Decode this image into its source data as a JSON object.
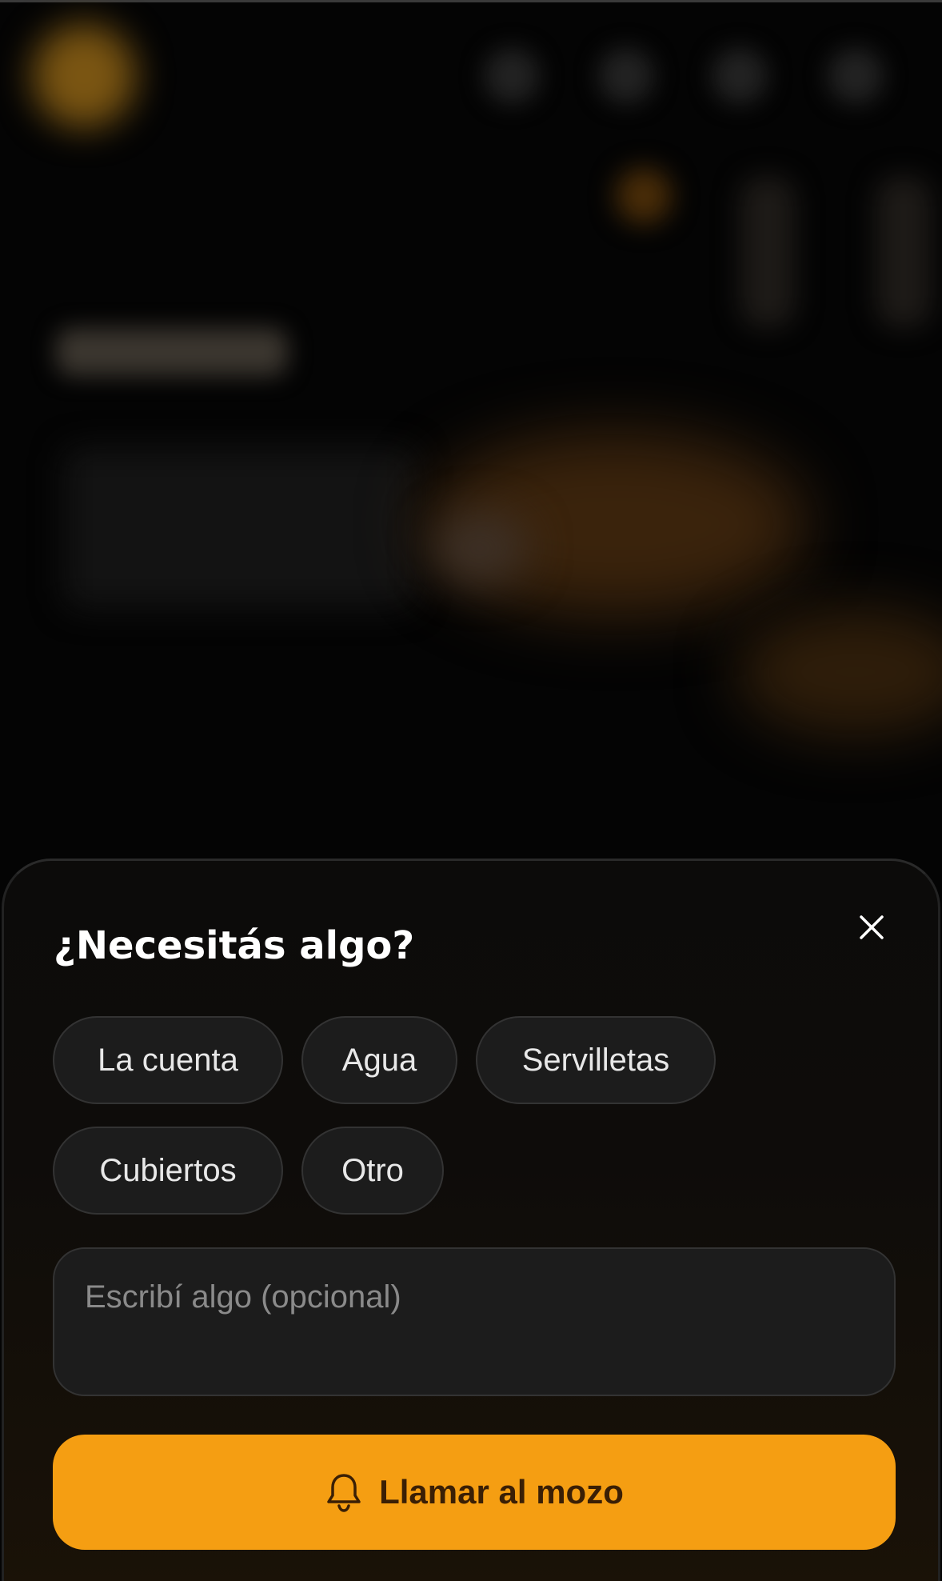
{
  "sheet": {
    "title": "¿Necesitás algo?",
    "close_icon": "close-icon",
    "options": [
      {
        "label": "La cuenta"
      },
      {
        "label": "Agua"
      },
      {
        "label": "Servilletas"
      },
      {
        "label": "Cubiertos"
      },
      {
        "label": "Otro"
      }
    ],
    "note": {
      "placeholder": "Escribí algo (opcional)",
      "value": ""
    },
    "call_button": {
      "label": "Llamar al mozo",
      "icon": "bell-icon"
    }
  },
  "colors": {
    "accent": "#f59e12",
    "accent_text": "#3a1f05",
    "sheet_background": "#0c0b0a",
    "chip_background": "#1c1c1c"
  }
}
